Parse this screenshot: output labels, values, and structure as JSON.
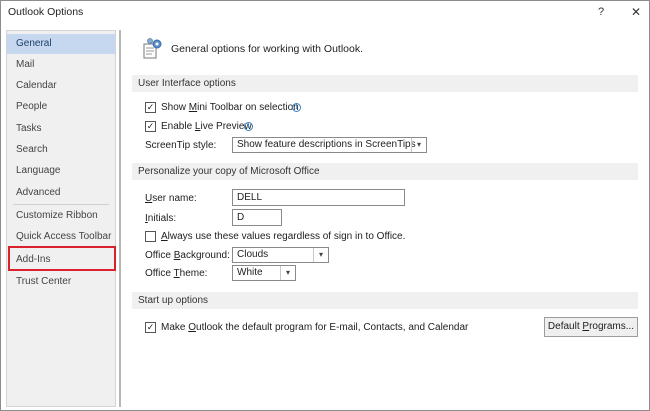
{
  "window": {
    "title": "Outlook Options",
    "help_label": "?",
    "close_label": "✕"
  },
  "sidebar": {
    "items": [
      {
        "label": "General"
      },
      {
        "label": "Mail"
      },
      {
        "label": "Calendar"
      },
      {
        "label": "People"
      },
      {
        "label": "Tasks"
      },
      {
        "label": "Search"
      },
      {
        "label": "Language"
      },
      {
        "label": "Advanced"
      },
      {
        "label": "Customize Ribbon"
      },
      {
        "label": "Quick Access Toolbar"
      },
      {
        "label": "Add-Ins"
      },
      {
        "label": "Trust Center"
      }
    ],
    "selected": "General",
    "highlighted": "Add-Ins",
    "highlight_color": "#d9222d",
    "selected_bg": "#c5d8ef"
  },
  "main": {
    "header_text": "General options for working with Outlook.",
    "ui_section": {
      "title": "User Interface options",
      "mini_toolbar": {
        "pre": "Show ",
        "key": "M",
        "post": "ini Toolbar on selection",
        "checked": true
      },
      "live_preview": {
        "pre": "Enable ",
        "key": "L",
        "post": "ive Preview",
        "checked": true
      },
      "screentip": {
        "label": "ScreenTip style:",
        "value": "Show feature descriptions in ScreenTips"
      }
    },
    "personalize_section": {
      "title": "Personalize your copy of Microsoft Office",
      "username": {
        "key": "U",
        "post": "ser name:",
        "value": "DELL"
      },
      "initials": {
        "key": "I",
        "post": "nitials:",
        "value": "D"
      },
      "always_use": {
        "key": "A",
        "post": "lways use these values regardless of sign in to Office.",
        "checked": false
      },
      "background": {
        "pre": "Office ",
        "key": "B",
        "post": "ackground:",
        "value": "Clouds"
      },
      "theme": {
        "pre": "Office ",
        "key": "T",
        "post": "heme:",
        "value": "White"
      }
    },
    "startup_section": {
      "title": "Start up options",
      "default_program": {
        "pre": "Make ",
        "key": "O",
        "post": "utlook the default program for E-mail, Contacts, and Calendar",
        "checked": true
      },
      "default_programs_button": {
        "pre": "Default ",
        "key": "P",
        "post": "rograms..."
      }
    }
  },
  "icons": {
    "check": "✓",
    "dropdown": "▾",
    "info": "i"
  }
}
